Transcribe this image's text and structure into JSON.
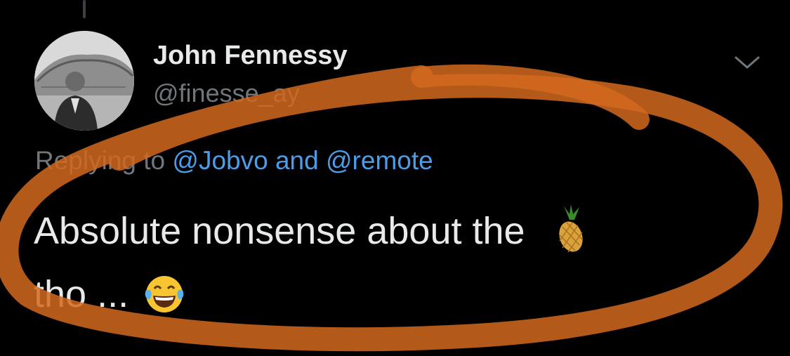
{
  "tweet": {
    "author": {
      "display_name": "John Fennessy",
      "handle": "@finesse_ay"
    },
    "reply": {
      "prefix": "Replying to",
      "mentions": [
        "@Jobvo",
        "@remote"
      ],
      "joiner": "and"
    },
    "text": {
      "line1": "Absolute nonsense about the",
      "line2": "tho ..."
    },
    "emojis": [
      "pineapple-emoji",
      "face-with-tears-of-joy-emoji"
    ]
  },
  "icons": {
    "more": "chevron-down-icon",
    "avatar": "avatar"
  },
  "colors": {
    "background": "#000000",
    "text": "#e7e9ea",
    "secondary_text": "#71767b",
    "mention": "#4b9dea",
    "annotation_stroke": "#d2691e"
  }
}
